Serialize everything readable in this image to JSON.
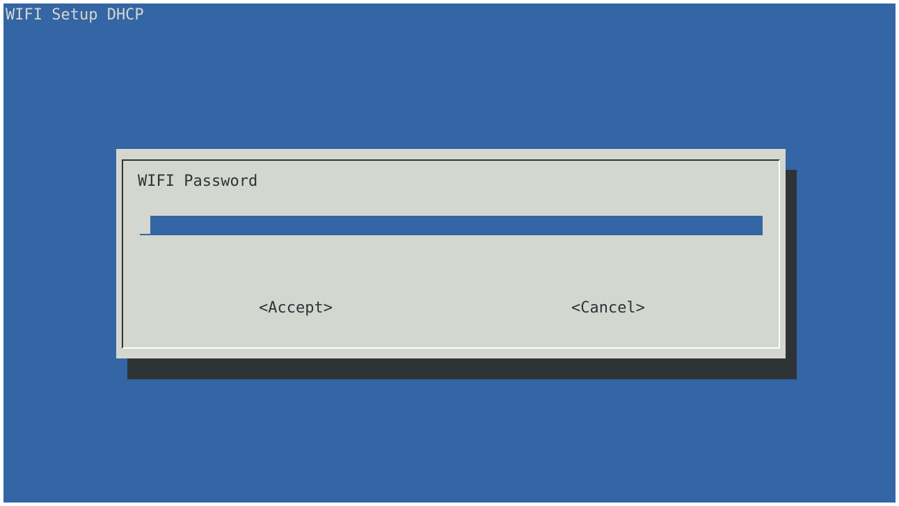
{
  "backtitle": "WIFI Setup DHCP",
  "dialog": {
    "prompt": "WIFI Password",
    "input_value": "",
    "buttons": {
      "accept": "<Accept>",
      "cancel": "<Cancel>"
    }
  },
  "colors": {
    "background": "#3465a4",
    "dialog": "#d3d7cf",
    "shadow": "#2e3436",
    "text": "#2e3436"
  }
}
